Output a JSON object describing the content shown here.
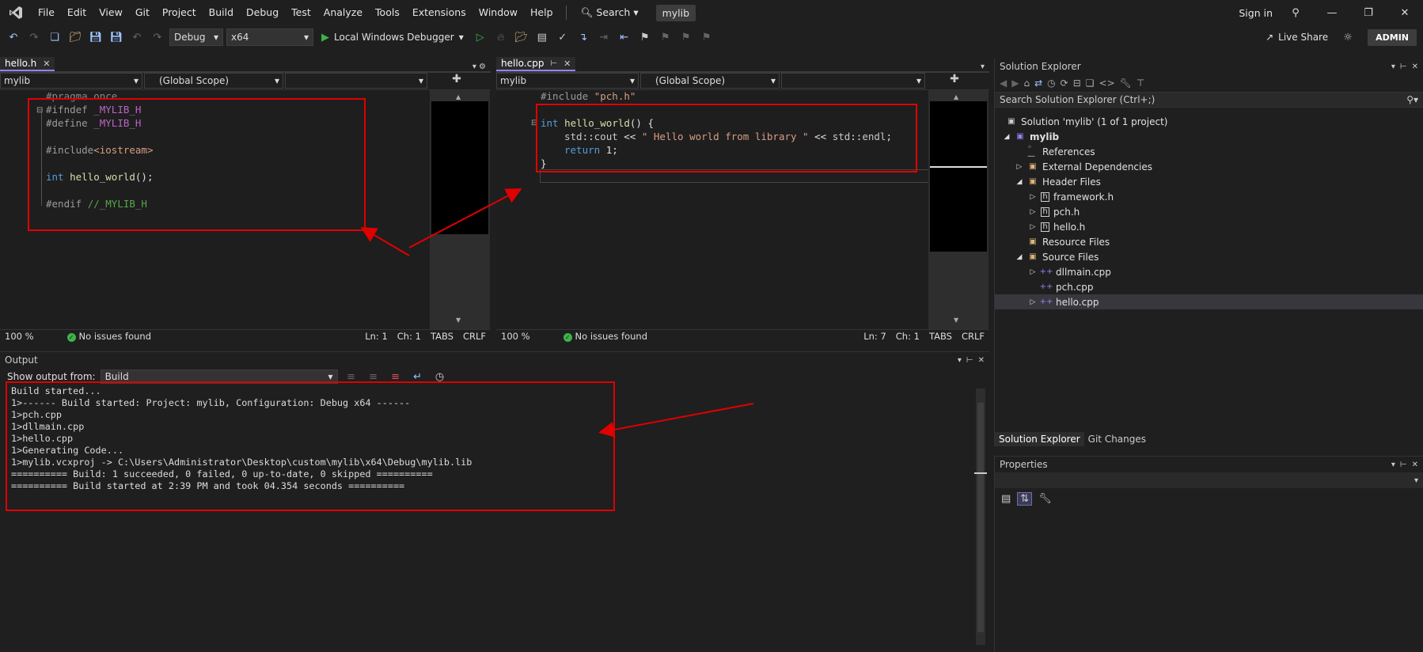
{
  "menu": {
    "items": [
      "File",
      "Edit",
      "View",
      "Git",
      "Project",
      "Build",
      "Debug",
      "Test",
      "Analyze",
      "Tools",
      "Extensions",
      "Window",
      "Help"
    ],
    "search_label": "Search",
    "project_name": "mylib",
    "sign_in": "Sign in"
  },
  "toolbar": {
    "configuration": "Debug",
    "platform": "x64",
    "run_target": "Local Windows Debugger",
    "live_share": "Live Share",
    "user_badge": "ADMIN"
  },
  "left_editor": {
    "tab_label": "hello.h",
    "project_dropdown": "mylib",
    "scope_dropdown": "(Global Scope)",
    "lines": [
      "#pragma once",
      "#ifndef _MYLIB_H",
      "#define _MYLIB_H",
      "#include<iostream>",
      "int hello_world();",
      "#endif //_MYLIB_H"
    ],
    "status": {
      "zoom": "100 %",
      "issues": "No issues found",
      "line": "Ln: 1",
      "col": "Ch: 1",
      "indent": "TABS",
      "eol": "CRLF"
    }
  },
  "right_editor": {
    "tab_label": "hello.cpp",
    "project_dropdown": "mylib",
    "scope_dropdown": "(Global Scope)",
    "status": {
      "zoom": "100 %",
      "issues": "No issues found",
      "line": "Ln: 7",
      "col": "Ch: 1",
      "indent": "TABS",
      "eol": "CRLF"
    }
  },
  "output": {
    "title": "Output",
    "show_from_label": "Show output from:",
    "source": "Build",
    "text": "Build started...\n1>------ Build started: Project: mylib, Configuration: Debug x64 ------\n1>pch.cpp\n1>dllmain.cpp\n1>hello.cpp\n1>Generating Code...\n1>mylib.vcxproj -> C:\\Users\\Administrator\\Desktop\\custom\\mylib\\x64\\Debug\\mylib.lib\n========== Build: 1 succeeded, 0 failed, 0 up-to-date, 0 skipped ==========\n========== Build started at 2:39 PM and took 04.354 seconds =========="
  },
  "solution_explorer": {
    "title": "Solution Explorer",
    "search_placeholder": "Search Solution Explorer (Ctrl+;)",
    "solution_label": "Solution 'mylib' (1 of 1 project)",
    "project": "mylib",
    "references": "References",
    "external_deps": "External Dependencies",
    "header_files": "Header Files",
    "headers": [
      "framework.h",
      "pch.h",
      "hello.h"
    ],
    "resource_files": "Resource Files",
    "source_files": "Source Files",
    "sources": [
      "dllmain.cpp",
      "pch.cpp",
      "hello.cpp"
    ],
    "bottom_tabs": [
      "Solution Explorer",
      "Git Changes"
    ]
  },
  "properties": {
    "title": "Properties"
  },
  "colors": {
    "accent": "#9184ee",
    "annotation_red": "#e00000",
    "success_green": "#3cb34a"
  }
}
